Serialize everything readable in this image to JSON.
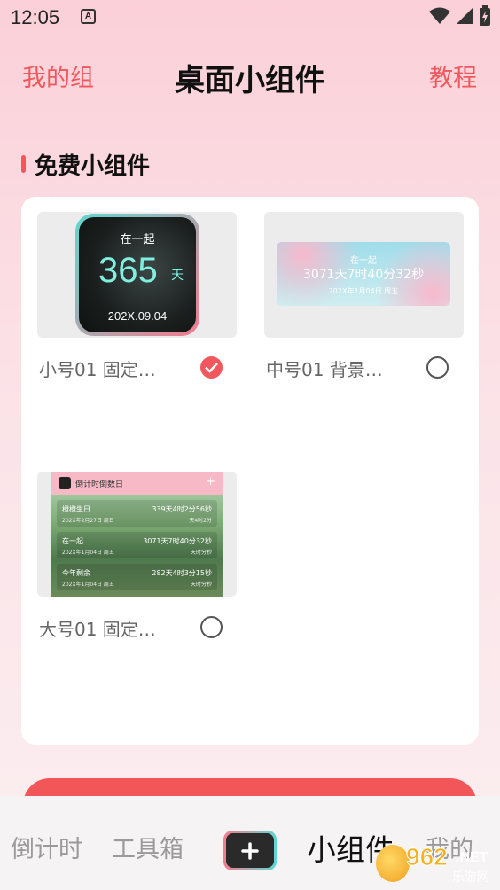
{
  "status_bar": {
    "time": "12:05",
    "notif_glyph": "A"
  },
  "header": {
    "left_link": "我的组",
    "title": "桌面小组件",
    "right_link": "教程"
  },
  "section": {
    "title": "免费小组件"
  },
  "widgets": [
    {
      "label": "小号01 固定…",
      "selected": true,
      "preview": {
        "top": "在一起",
        "value": "365",
        "unit": "天",
        "date": "202X.09.04"
      }
    },
    {
      "label": "中号01 背景…",
      "selected": false,
      "preview": {
        "top": "在一起",
        "value": "3071天7时40分32秒",
        "date": "202X年1月04日 周五"
      }
    },
    {
      "label": "大号01 固定…",
      "selected": false,
      "preview": {
        "header": "倒计时倒数日",
        "plus": "+",
        "rows": [
          {
            "name": "橙橙生日",
            "value": "339天4时2分56秒",
            "sub_left": "202X年2月27日 周日",
            "sub_right": "天4时2分"
          },
          {
            "name": "在一起",
            "value": "3071天7时40分32秒",
            "sub_left": "202X年1月04日 周五",
            "sub_right": "天时分秒"
          },
          {
            "name": "今年剩余",
            "value": "282天4时3分15秒",
            "sub_left": "202X年1月04日 周五",
            "sub_right": "天时分秒"
          }
        ]
      }
    }
  ],
  "tabbar": {
    "tabs": [
      "倒计时",
      "工具箱",
      "小组件",
      "我的"
    ],
    "active": "小组件",
    "plus_glyph": "+"
  },
  "watermark": {
    "number": "962",
    "suffix": ".NET",
    "sub": "乐游网"
  },
  "colors": {
    "accent": "#f0585e",
    "panel": "#ffffff"
  }
}
